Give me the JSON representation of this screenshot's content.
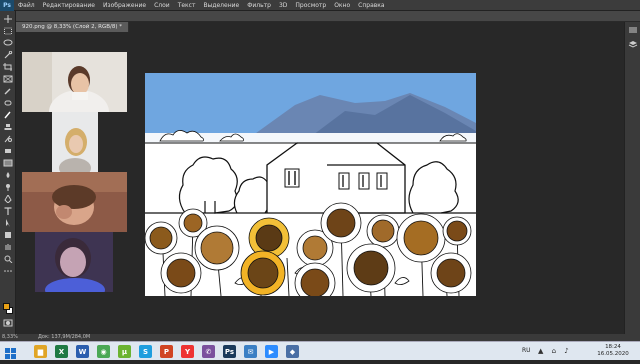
{
  "menubar": {
    "logo": "Ps",
    "items": [
      "Файл",
      "Редактирование",
      "Изображение",
      "Слои",
      "Текст",
      "Выделение",
      "Фильтр",
      "3D",
      "Просмотр",
      "Окно",
      "Справка"
    ]
  },
  "document": {
    "tab_title": "920.png @ 8,33% (Слой 2, RGB/8) *"
  },
  "statusbar": {
    "zoom": "8,33%",
    "docinfo": "Док: 137,9M/284,0M"
  },
  "colors": {
    "foreground": "#e8a015",
    "background": "#ffffff"
  },
  "taskbar": {
    "apps": [
      {
        "name": "file-explorer-icon",
        "glyph": "▆",
        "color": "#e0a526"
      },
      {
        "name": "excel-icon",
        "glyph": "X",
        "color": "#1f7a43"
      },
      {
        "name": "word-icon",
        "glyph": "W",
        "color": "#2b5eae"
      },
      {
        "name": "chrome-icon",
        "glyph": "◉",
        "color": "#4aa855"
      },
      {
        "name": "utorrent-icon",
        "glyph": "µ",
        "color": "#6bb331"
      },
      {
        "name": "skype-icon",
        "glyph": "S",
        "color": "#1f9ede"
      },
      {
        "name": "powerpoint-icon",
        "glyph": "P",
        "color": "#d04423"
      },
      {
        "name": "yandex-icon",
        "glyph": "Y",
        "color": "#e33"
      },
      {
        "name": "viber-icon",
        "glyph": "✆",
        "color": "#7b519d"
      },
      {
        "name": "photoshop-icon",
        "glyph": "Ps",
        "color": "#1b3a5b"
      },
      {
        "name": "mail-icon",
        "glyph": "✉",
        "color": "#3b7fc4"
      },
      {
        "name": "zoom-icon",
        "glyph": "▶",
        "color": "#2d8cff"
      },
      {
        "name": "app-icon",
        "glyph": "◆",
        "color": "#4a6fa5"
      }
    ],
    "language": "RU",
    "time": "18:24",
    "date": "16.05.2020"
  }
}
